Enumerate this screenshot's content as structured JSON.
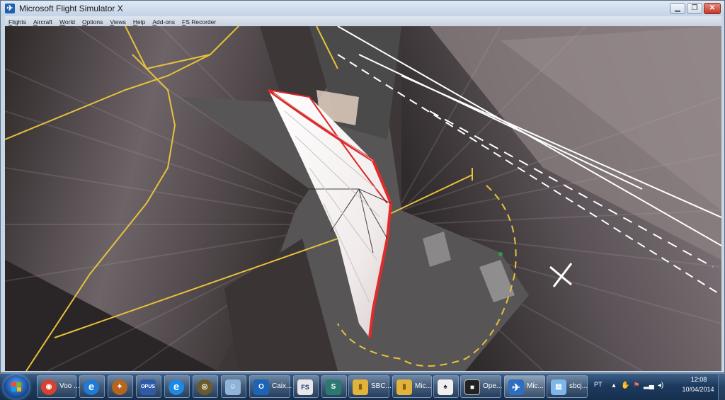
{
  "window": {
    "title": "Microsoft Flight Simulator X",
    "app_icon": "airplane-icon",
    "controls": {
      "minimize": "▁",
      "restore": "❐",
      "close": "✕"
    }
  },
  "menu": [
    "Flights",
    "Aircraft",
    "World",
    "Options",
    "Views",
    "Help",
    "Add-ons",
    "FS Recorder"
  ],
  "taskbar": {
    "buttons": [
      {
        "icon": "chrome-icon",
        "label": "Voo ...",
        "color": "#d8412f",
        "glyph": "◉"
      },
      {
        "icon": "internet-explorer-icon",
        "label": "",
        "color": "#1f7bd6",
        "glyph": "e"
      },
      {
        "icon": "compass-app-icon",
        "label": "",
        "color": "#b5651d",
        "glyph": "✦"
      },
      {
        "icon": "opus-icon",
        "label": "",
        "color": "#2f5aa8",
        "glyph": "OPUS"
      },
      {
        "icon": "ie-update-icon",
        "label": "",
        "color": "#1e88e5",
        "glyph": "e"
      },
      {
        "icon": "gauge-app-icon",
        "label": "",
        "color": "#6b5a2b",
        "glyph": "◎"
      },
      {
        "icon": "user-tile-icon",
        "label": "",
        "color": "#8fb3d9",
        "glyph": "☺"
      },
      {
        "icon": "outlook-icon",
        "label": "Caix...",
        "color": "#1b64b8",
        "glyph": "O"
      },
      {
        "icon": "fs-acars-icon",
        "label": "",
        "color": "#e8e8e8",
        "glyph": "FS"
      },
      {
        "icon": "python-icon",
        "label": "",
        "color": "#2b7a6f",
        "glyph": "S"
      },
      {
        "icon": "folder-icon",
        "label": "SBC...",
        "color": "#e2b33a",
        "glyph": "▮"
      },
      {
        "icon": "folder-icon",
        "label": "Mic...",
        "color": "#e2b33a",
        "glyph": "▮"
      },
      {
        "icon": "cards-icon",
        "label": "",
        "color": "#efefef",
        "glyph": "♠"
      },
      {
        "icon": "console-icon",
        "label": "Ope...",
        "color": "#222222",
        "glyph": "■"
      },
      {
        "icon": "airplane-icon",
        "label": "Mic...",
        "color": "#2c6fc0",
        "glyph": "✈"
      },
      {
        "icon": "notepad-icon",
        "label": "sbcj...",
        "color": "#7db6e8",
        "glyph": "▤"
      }
    ],
    "tray": {
      "language": "PT",
      "icons": [
        "show-hidden-icon",
        "hand-icon",
        "flag-icon",
        "network-icon",
        "volume-icon"
      ],
      "time": "12:08",
      "date": "10/04/2014"
    }
  },
  "colors": {
    "taxiline": "#e7c13c",
    "runway_marking": "#ffffff",
    "glider_sail": "#f4f1f0",
    "glider_edge": "#e32a2a",
    "tarmac": "#4f4e4e"
  }
}
